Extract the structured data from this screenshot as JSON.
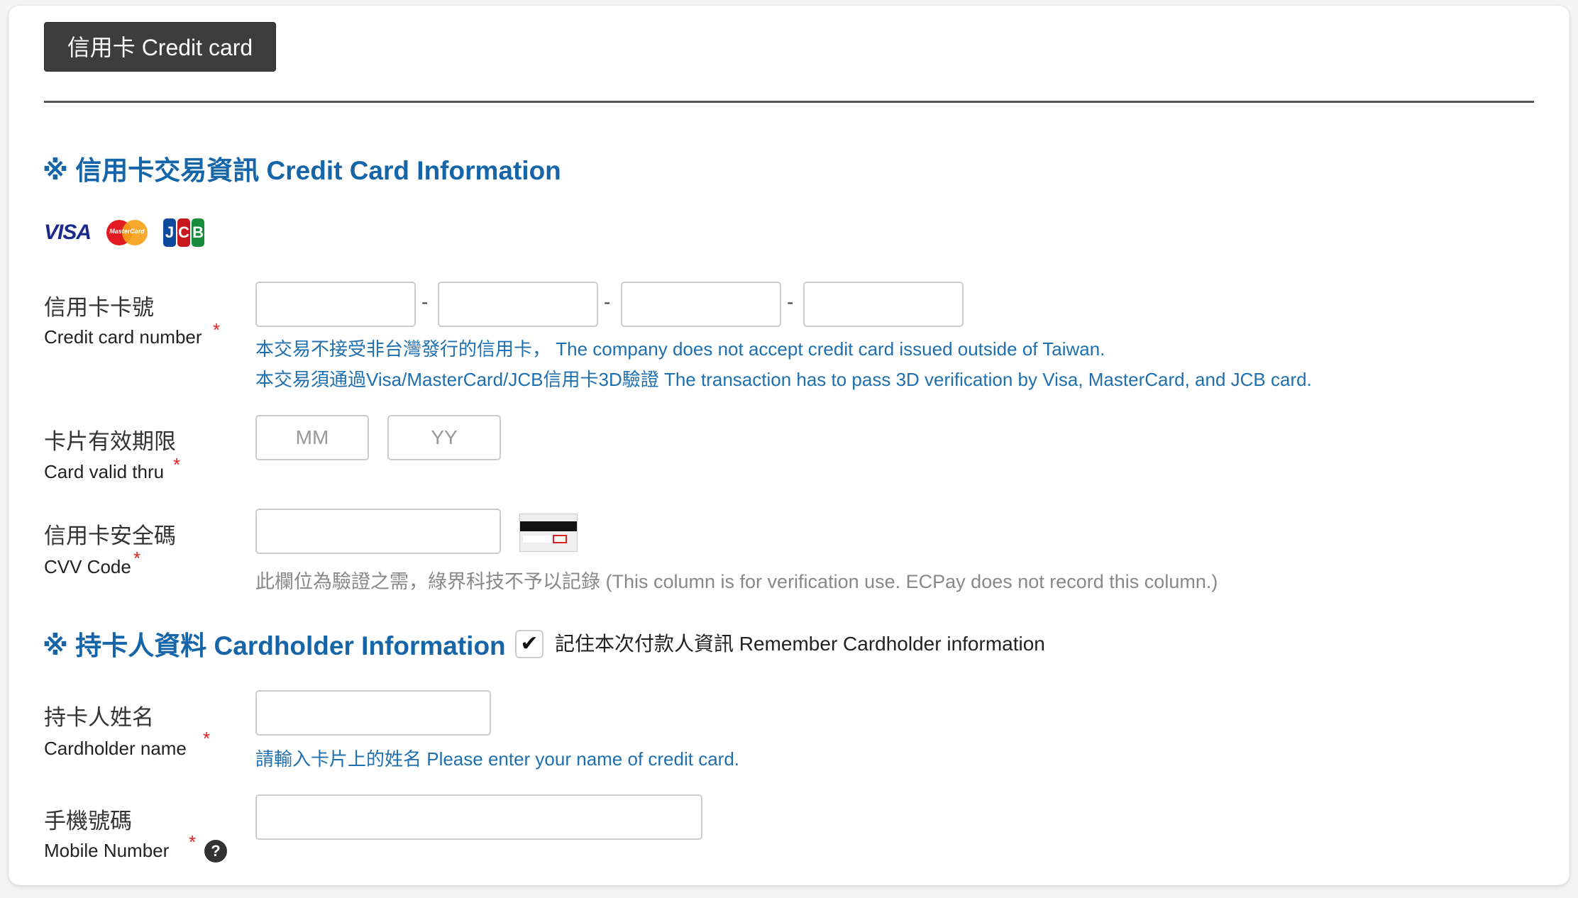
{
  "tab": {
    "label": "信用卡 Credit card"
  },
  "section_card": {
    "title": "※ 信用卡交易資訊 Credit Card Information"
  },
  "brands": {
    "visa": "VISA",
    "mastercard": "MasterCard",
    "jcb": [
      "J",
      "C",
      "B"
    ]
  },
  "card_number": {
    "label_zh": "信用卡卡號",
    "label_en": "Credit card number",
    "required": "*",
    "separator": "-",
    "note1": "本交易不接受非台灣發行的信用卡， The company does not accept credit card issued outside of Taiwan.",
    "note2": "本交易須通過Visa/MasterCard/JCB信用卡3D驗證 The transaction has to pass 3D verification by Visa, MasterCard, and JCB card."
  },
  "valid_thru": {
    "label_zh": "卡片有效期限",
    "label_en": "Card valid thru",
    "required": "*",
    "month_placeholder": "MM",
    "year_placeholder": "YY"
  },
  "cvv": {
    "label_zh": "信用卡安全碼",
    "label_en": "CVV Code",
    "required": "*",
    "note": "此欄位為驗證之需，綠界科技不予以記錄 (This column is for verification use. ECPay does not record this column.)"
  },
  "section_holder": {
    "title": "※ 持卡人資料 Cardholder Information"
  },
  "remember": {
    "checked_mark": "✔",
    "label": "記住本次付款人資訊 Remember Cardholder information"
  },
  "holder_name": {
    "label_zh": "持卡人姓名",
    "label_en": "Cardholder name",
    "required": "*",
    "note": "請輸入卡片上的姓名 Please enter your name of credit card."
  },
  "mobile": {
    "label_zh": "手機號碼",
    "label_en": "Mobile Number",
    "required": "*",
    "help": "?"
  },
  "colors": {
    "accent": "#1565a8",
    "note_blue": "#1f6fae",
    "required": "#dd2222",
    "tab_bg": "#3d3d3d"
  }
}
